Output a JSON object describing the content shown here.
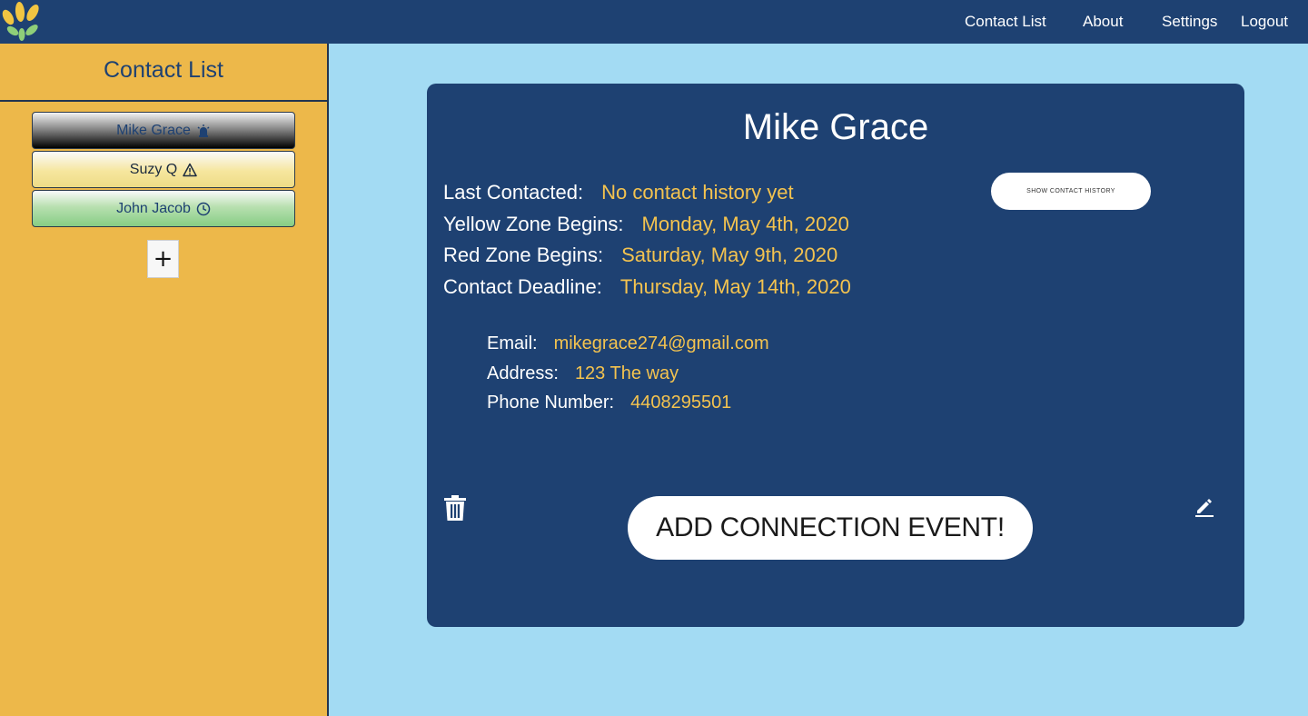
{
  "nav": {
    "links": [
      "Contact List",
      "About",
      "Settings",
      "Logout"
    ]
  },
  "sidebar": {
    "title": "Contact List",
    "contacts": [
      {
        "name": "Mike Grace",
        "status_icon": "alarm-icon"
      },
      {
        "name": "Suzy Q",
        "status_icon": "warning-icon"
      },
      {
        "name": "John Jacob",
        "status_icon": "clock-icon"
      }
    ],
    "add_label": "+"
  },
  "detail": {
    "name": "Mike Grace",
    "last_contacted_label": "Last Contacted:",
    "last_contacted_value": "No contact history yet",
    "yellow_zone_label": "Yellow Zone Begins:",
    "yellow_zone_value": "Monday, May 4th, 2020",
    "red_zone_label": "Red Zone Begins:",
    "red_zone_value": "Saturday, May 9th, 2020",
    "deadline_label": "Contact Deadline:",
    "deadline_value": "Thursday, May 14th, 2020",
    "email_label": "Email:",
    "email_value": "mikegrace274@gmail.com",
    "address_label": "Address:",
    "address_value": "123 The way",
    "phone_label": "Phone Number:",
    "phone_value": "4408295501",
    "history_button": "SHOW CONTACT HISTORY",
    "add_event_button": "ADD CONNECTION EVENT!"
  },
  "colors": {
    "navy": "#1e4172",
    "sidebar": "#edb84a",
    "background": "#a3dbf3",
    "value_text": "#f4c34f"
  }
}
